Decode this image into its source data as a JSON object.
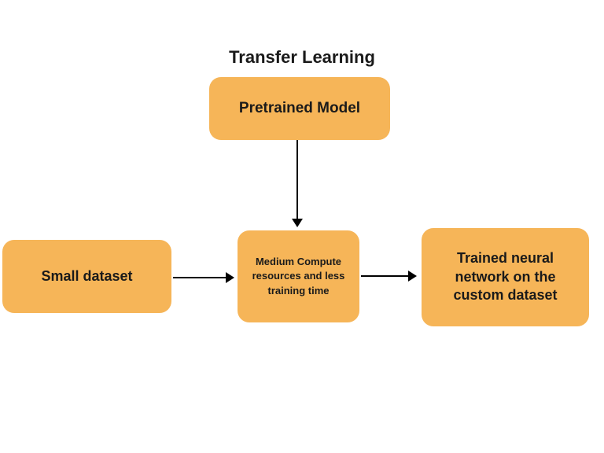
{
  "diagram": {
    "title": "Transfer Learning",
    "nodes": {
      "pretrained": "Pretrained Model",
      "small_dataset": "Small dataset",
      "medium_compute": "Medium Compute resources and less training time",
      "trained_nn": "Trained neural network on the custom dataset"
    },
    "edges": [
      {
        "from": "pretrained",
        "to": "medium_compute"
      },
      {
        "from": "small_dataset",
        "to": "medium_compute"
      },
      {
        "from": "medium_compute",
        "to": "trained_nn"
      }
    ],
    "colors": {
      "box_fill": "#f6b558",
      "text": "#1a1a1a",
      "arrow": "#000000"
    }
  }
}
